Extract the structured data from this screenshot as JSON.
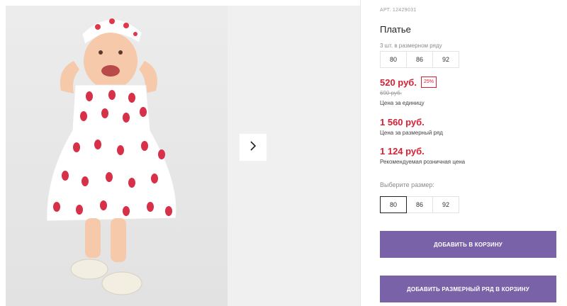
{
  "product": {
    "article": "АРТ. 12429031",
    "title": "Платье",
    "set_label": "3 шт. в размерном ряду",
    "set_sizes": [
      "80",
      "86",
      "92"
    ],
    "price": "520 руб.",
    "discount": "25%",
    "old_price": "690 руб.",
    "unit_price_note": "Цена за единицу",
    "set_price": "1 560 руб.",
    "set_price_note": "Цена за размерный ряд",
    "retail_price": "1 124 руб.",
    "retail_price_note": "Рекомендуемая розничная цена",
    "choose_size_label": "Выберите размер:",
    "size_options": [
      "80",
      "86",
      "92"
    ],
    "selected_size": "80"
  },
  "actions": {
    "add_to_cart": "ДОБАВИТЬ В КОРЗИНУ",
    "add_set_to_cart": "ДОБАВИТЬ РАЗМЕРНЫЙ РЯД В КОРЗИНУ"
  },
  "icons": {
    "next": "chevron-right-icon"
  },
  "colors": {
    "accent_red": "#d71f34",
    "button_purple": "#7a62a8"
  }
}
